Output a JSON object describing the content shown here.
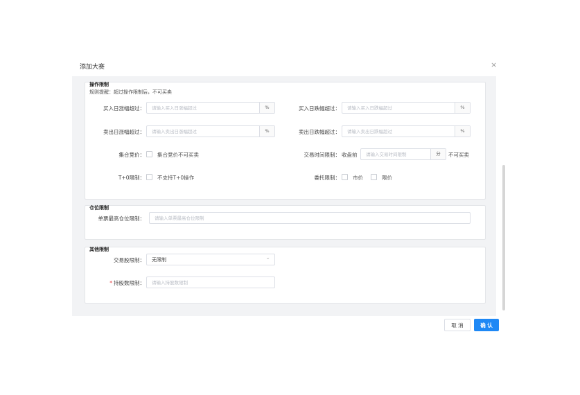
{
  "dialog": {
    "title": "添加大赛",
    "close": "×"
  },
  "operation": {
    "title": "操作限制",
    "hint": "规则提醒：超过操作限制后，不可买卖",
    "buy_rise": {
      "label": "买入日涨幅超过：",
      "placeholder": "请输入买入日涨幅超过",
      "suffix": "%"
    },
    "buy_fall": {
      "label": "买入日跌幅超过：",
      "placeholder": "请输入买入日跌幅超过",
      "suffix": "%"
    },
    "sell_rise": {
      "label": "卖出日涨幅超过：",
      "placeholder": "请输入卖出日涨幅超过",
      "suffix": "%"
    },
    "sell_fall": {
      "label": "卖出日跌幅超过：",
      "placeholder": "请输入卖出日跌幅超过",
      "suffix": "%"
    },
    "auction": {
      "label": "集合竞价：",
      "option": "集合竞价不可买卖"
    },
    "trade_time": {
      "label": "交易时间限制：",
      "prefix": "收盘前",
      "placeholder": "请输入交易时间限制",
      "unit": "分",
      "after": "不可买卖"
    },
    "t0": {
      "label": "T+0限制：",
      "option": "不支持T+0操作"
    },
    "order": {
      "label": "委托限制：",
      "market": "市价",
      "limit": "限价"
    }
  },
  "position": {
    "title": "仓位限制",
    "single": {
      "label": "单票最高仓位限制：",
      "placeholder": "请输入单票最高仓位限制"
    }
  },
  "other": {
    "title": "其他限制",
    "trade_stock": {
      "label": "交易股限制：",
      "value": "无限制"
    },
    "holding": {
      "required": "*",
      "label": "持股数限制：",
      "placeholder": "请输入持股数限制"
    }
  },
  "footer": {
    "cancel": "取 消",
    "confirm": "确 认"
  },
  "colors": {
    "primary": "#1e88f5",
    "required": "#e4393c",
    "panel_bg": "#f2f3f5"
  }
}
